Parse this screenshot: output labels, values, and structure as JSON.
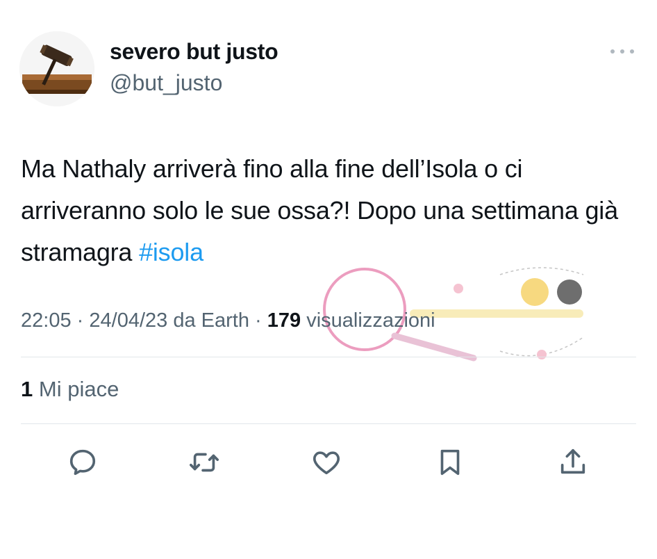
{
  "user": {
    "display_name": "severo but justo",
    "handle": "@but_justo"
  },
  "tweet": {
    "text": "Ma Nathaly arriverà fino alla fine dell’Isola o ci arriveranno solo le sue ossa?! Dopo una settimana già stramagra ",
    "hashtag": "#isola",
    "time": "22:05",
    "date": "24/04/23",
    "source_prefix": "da",
    "source": "Earth",
    "separator": "·",
    "views_count": "179",
    "views_label": "visualizzazioni",
    "likes_count": "1",
    "likes_label": "Mi piace"
  },
  "actions": [
    "reply-icon",
    "retweet-icon",
    "like-icon",
    "bookmark-icon",
    "share-icon"
  ],
  "colors": {
    "text": "#0f1419",
    "secondary": "#536471",
    "accent": "#1d9bf0"
  }
}
